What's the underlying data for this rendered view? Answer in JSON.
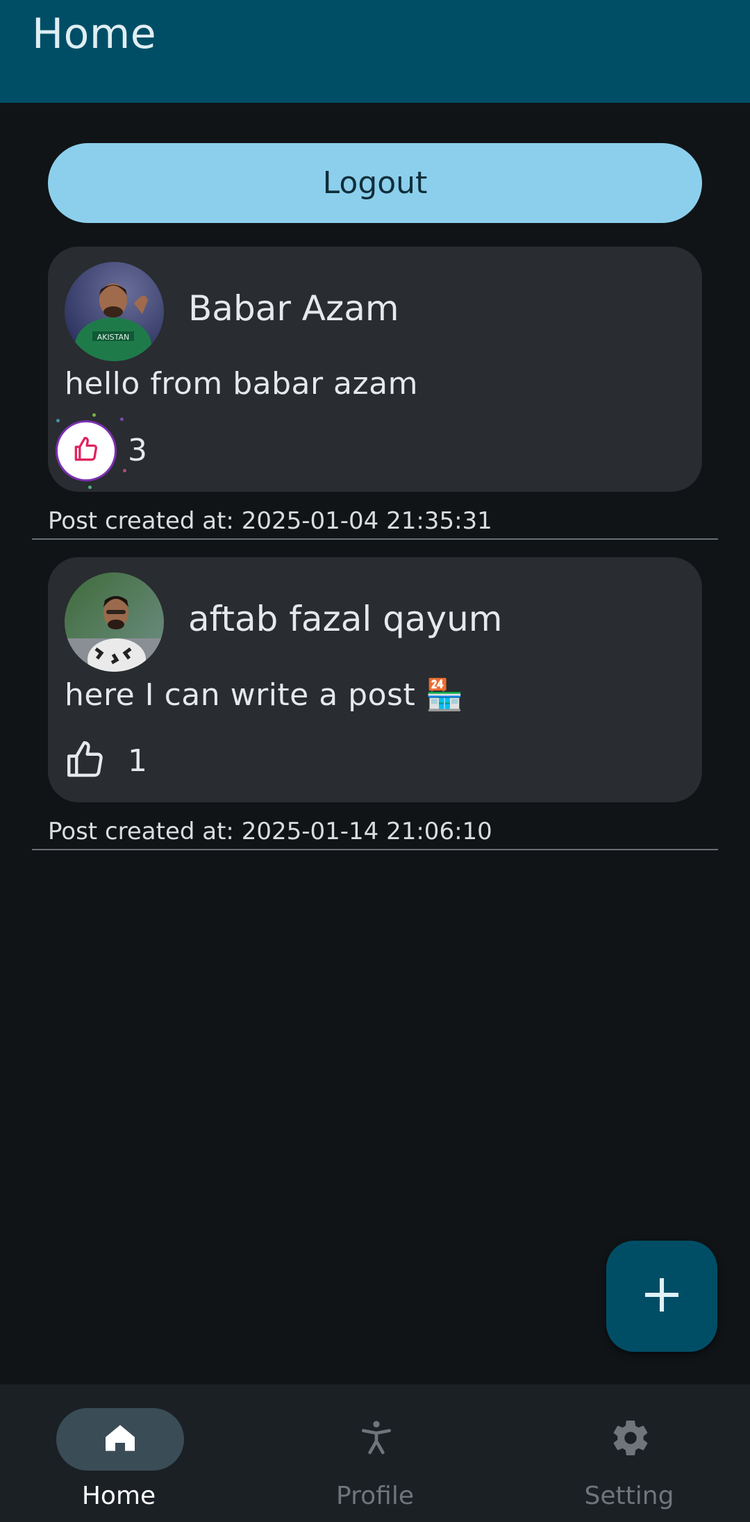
{
  "app_bar": {
    "title": "Home"
  },
  "logout_label": "Logout",
  "posts": [
    {
      "author": "Babar Azam",
      "content": "hello from babar azam",
      "likes": "3",
      "liked": true,
      "created_at": "Post created at: 2025-01-04 21:35:31"
    },
    {
      "author": "aftab fazal qayum",
      "content": "here I can write a post 🏪",
      "likes": "1",
      "liked": false,
      "created_at": "Post created at: 2025-01-14 21:06:10"
    }
  ],
  "bottom_nav": {
    "items": [
      {
        "label": "Home",
        "icon": "home-icon",
        "selected": true
      },
      {
        "label": "Profile",
        "icon": "accessibility-icon",
        "selected": false
      },
      {
        "label": "Setting",
        "icon": "gear-icon",
        "selected": false
      }
    ]
  },
  "colors": {
    "app_bar": "#004e66",
    "background": "#101417",
    "logout_button": "#8ccfec",
    "card": "#292c30",
    "fab": "#004e66",
    "like_active": "#e0245e"
  }
}
